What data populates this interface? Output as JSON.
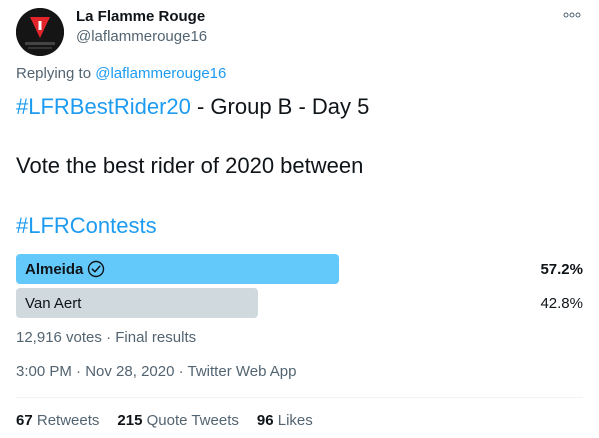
{
  "account": {
    "name": "La Flamme Rouge",
    "handle": "@laflammerouge16",
    "avatar_icon": "la-flamme-rouge-logo-icon"
  },
  "reply": {
    "prefix": "Replying to",
    "mention": "@laflammerouge16"
  },
  "tweet": {
    "hashtag1": "#LFRBestRider20",
    "line1_rest": " - Group B - Day 5",
    "line2": "Vote the best rider of 2020 between",
    "hashtag2": "#LFRContests"
  },
  "poll": {
    "options": [
      {
        "label": "Almeida",
        "percent_text": "57.2%",
        "fraction": 0.572,
        "winner": true,
        "color": "#63c8fa"
      },
      {
        "label": "Van Aert",
        "percent_text": "42.8%",
        "fraction": 0.428,
        "winner": false,
        "color": "#cfd9de"
      }
    ],
    "votes_text": "12,916 votes",
    "separator": " · ",
    "status_text": "Final results"
  },
  "timestamp": {
    "time": "3:00 PM",
    "date": "Nov 28, 2020",
    "separator": " · ",
    "source": "Twitter Web App"
  },
  "stats": {
    "retweets_count": "67",
    "retweets_label": "Retweets",
    "quotes_count": "215",
    "quotes_label": "Quote Tweets",
    "likes_count": "96",
    "likes_label": "Likes"
  },
  "colors": {
    "link": "#1d9bf0",
    "secondary_text": "#536471",
    "primary_text": "#0f1419"
  }
}
